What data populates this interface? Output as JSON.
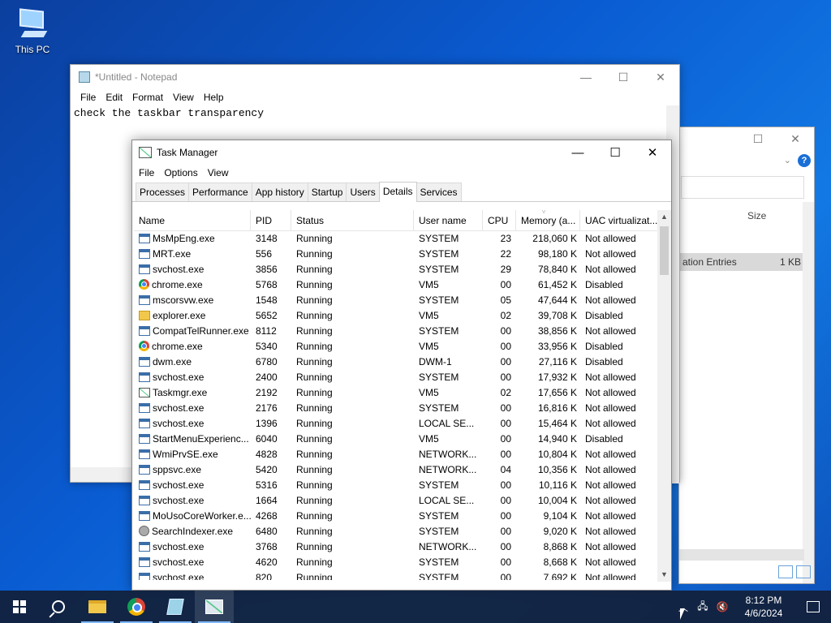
{
  "desktop": {
    "icon_label": "This PC"
  },
  "notepad": {
    "title": "*Untitled - Notepad",
    "menu": [
      "File",
      "Edit",
      "Format",
      "View",
      "Help"
    ],
    "content": "check the taskbar transparency"
  },
  "explorer": {
    "size_header": "Size",
    "row_name": "ation Entries",
    "row_size": "1 KB",
    "help": "?"
  },
  "taskmgr": {
    "title": "Task Manager",
    "menu": [
      "File",
      "Options",
      "View"
    ],
    "tabs": [
      "Processes",
      "Performance",
      "App history",
      "Startup",
      "Users",
      "Details",
      "Services"
    ],
    "active_tab": "Details",
    "columns": [
      "Name",
      "PID",
      "Status",
      "User name",
      "CPU",
      "Memory (a...",
      "UAC virtualizat..."
    ],
    "rows": [
      {
        "icon": "app",
        "name": "MsMpEng.exe",
        "pid": "3148",
        "status": "Running",
        "user": "SYSTEM",
        "cpu": "23",
        "mem": "218,060 K",
        "uac": "Not allowed"
      },
      {
        "icon": "app",
        "name": "MRT.exe",
        "pid": "556",
        "status": "Running",
        "user": "SYSTEM",
        "cpu": "22",
        "mem": "98,180 K",
        "uac": "Not allowed"
      },
      {
        "icon": "app",
        "name": "svchost.exe",
        "pid": "3856",
        "status": "Running",
        "user": "SYSTEM",
        "cpu": "29",
        "mem": "78,840 K",
        "uac": "Not allowed"
      },
      {
        "icon": "chrome",
        "name": "chrome.exe",
        "pid": "5768",
        "status": "Running",
        "user": "VM5",
        "cpu": "00",
        "mem": "61,452 K",
        "uac": "Disabled"
      },
      {
        "icon": "app",
        "name": "mscorsvw.exe",
        "pid": "1548",
        "status": "Running",
        "user": "SYSTEM",
        "cpu": "05",
        "mem": "47,644 K",
        "uac": "Not allowed"
      },
      {
        "icon": "folder",
        "name": "explorer.exe",
        "pid": "5652",
        "status": "Running",
        "user": "VM5",
        "cpu": "02",
        "mem": "39,708 K",
        "uac": "Disabled"
      },
      {
        "icon": "app",
        "name": "CompatTelRunner.exe",
        "pid": "8112",
        "status": "Running",
        "user": "SYSTEM",
        "cpu": "00",
        "mem": "38,856 K",
        "uac": "Not allowed"
      },
      {
        "icon": "chrome",
        "name": "chrome.exe",
        "pid": "5340",
        "status": "Running",
        "user": "VM5",
        "cpu": "00",
        "mem": "33,956 K",
        "uac": "Disabled"
      },
      {
        "icon": "app",
        "name": "dwm.exe",
        "pid": "6780",
        "status": "Running",
        "user": "DWM-1",
        "cpu": "00",
        "mem": "27,116 K",
        "uac": "Disabled"
      },
      {
        "icon": "app",
        "name": "svchost.exe",
        "pid": "2400",
        "status": "Running",
        "user": "SYSTEM",
        "cpu": "00",
        "mem": "17,932 K",
        "uac": "Not allowed"
      },
      {
        "icon": "tm",
        "name": "Taskmgr.exe",
        "pid": "2192",
        "status": "Running",
        "user": "VM5",
        "cpu": "02",
        "mem": "17,656 K",
        "uac": "Not allowed"
      },
      {
        "icon": "app",
        "name": "svchost.exe",
        "pid": "2176",
        "status": "Running",
        "user": "SYSTEM",
        "cpu": "00",
        "mem": "16,816 K",
        "uac": "Not allowed"
      },
      {
        "icon": "app",
        "name": "svchost.exe",
        "pid": "1396",
        "status": "Running",
        "user": "LOCAL SE...",
        "cpu": "00",
        "mem": "15,464 K",
        "uac": "Not allowed"
      },
      {
        "icon": "app",
        "name": "StartMenuExperienc...",
        "pid": "6040",
        "status": "Running",
        "user": "VM5",
        "cpu": "00",
        "mem": "14,940 K",
        "uac": "Disabled"
      },
      {
        "icon": "app",
        "name": "WmiPrvSE.exe",
        "pid": "4828",
        "status": "Running",
        "user": "NETWORK...",
        "cpu": "00",
        "mem": "10,804 K",
        "uac": "Not allowed"
      },
      {
        "icon": "app",
        "name": "sppsvc.exe",
        "pid": "5420",
        "status": "Running",
        "user": "NETWORK...",
        "cpu": "04",
        "mem": "10,356 K",
        "uac": "Not allowed"
      },
      {
        "icon": "app",
        "name": "svchost.exe",
        "pid": "5316",
        "status": "Running",
        "user": "SYSTEM",
        "cpu": "00",
        "mem": "10,116 K",
        "uac": "Not allowed"
      },
      {
        "icon": "app",
        "name": "svchost.exe",
        "pid": "1664",
        "status": "Running",
        "user": "LOCAL SE...",
        "cpu": "00",
        "mem": "10,004 K",
        "uac": "Not allowed"
      },
      {
        "icon": "app",
        "name": "MoUsoCoreWorker.e...",
        "pid": "4268",
        "status": "Running",
        "user": "SYSTEM",
        "cpu": "00",
        "mem": "9,104 K",
        "uac": "Not allowed"
      },
      {
        "icon": "user",
        "name": "SearchIndexer.exe",
        "pid": "6480",
        "status": "Running",
        "user": "SYSTEM",
        "cpu": "00",
        "mem": "9,020 K",
        "uac": "Not allowed"
      },
      {
        "icon": "app",
        "name": "svchost.exe",
        "pid": "3768",
        "status": "Running",
        "user": "NETWORK...",
        "cpu": "00",
        "mem": "8,868 K",
        "uac": "Not allowed"
      },
      {
        "icon": "app",
        "name": "svchost.exe",
        "pid": "4620",
        "status": "Running",
        "user": "SYSTEM",
        "cpu": "00",
        "mem": "8,668 K",
        "uac": "Not allowed"
      },
      {
        "icon": "app",
        "name": "svchost.exe",
        "pid": "820",
        "status": "Running",
        "user": "SYSTEM",
        "cpu": "00",
        "mem": "7,692 K",
        "uac": "Not allowed"
      }
    ]
  },
  "taskbar": {
    "apps": [
      "start-button",
      "search-button",
      "file-explorer",
      "chrome",
      "notepad",
      "task-manager"
    ],
    "time": "8:12 PM",
    "date": "4/6/2024"
  }
}
